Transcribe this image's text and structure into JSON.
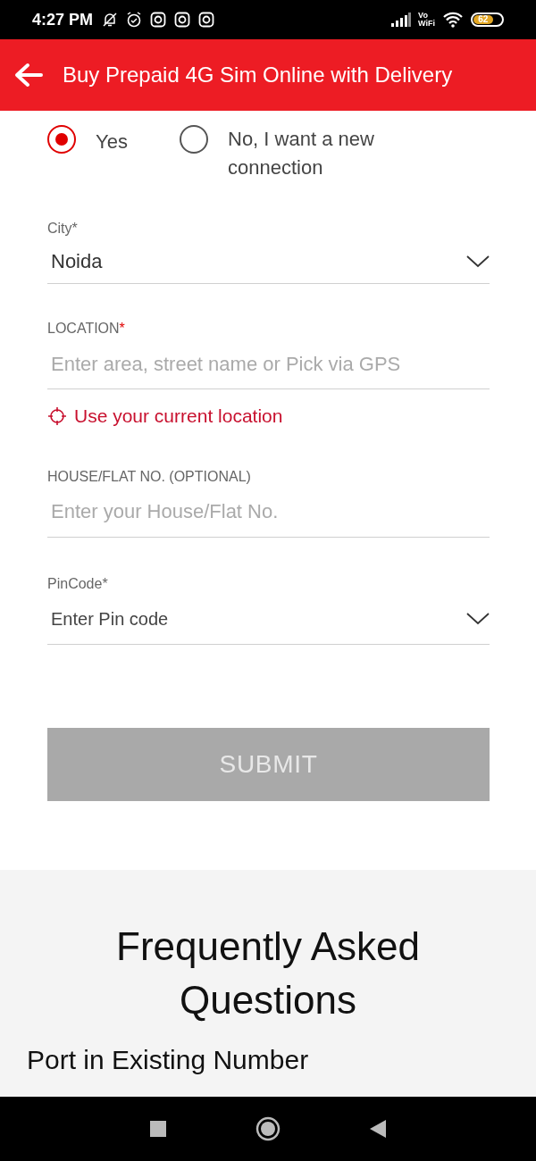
{
  "status_bar": {
    "time": "4:27 PM",
    "vowifi_top": "Vo",
    "vowifi_bottom": "WiFi",
    "battery": "62"
  },
  "header": {
    "title": "Buy Prepaid 4G Sim Online with Delivery"
  },
  "connection_options": [
    {
      "label": "Yes",
      "selected": true
    },
    {
      "label": "No, I want a new connection",
      "selected": false
    }
  ],
  "city": {
    "label": "City*",
    "value": "Noida"
  },
  "location": {
    "label": "LOCATION",
    "required_mark": "*",
    "placeholder": "Enter area, street name or Pick via GPS",
    "gps_link": "Use your current location"
  },
  "house": {
    "label": "HOUSE/FLAT NO. (OPTIONAL)",
    "placeholder": "Enter your House/Flat No."
  },
  "pincode": {
    "label": "PinCode*",
    "value": "Enter Pin code"
  },
  "submit": {
    "label": "SUBMIT",
    "disabled": true
  },
  "faq": {
    "title": "Frequently Asked Questions",
    "first_question": "Port in Existing Number"
  }
}
